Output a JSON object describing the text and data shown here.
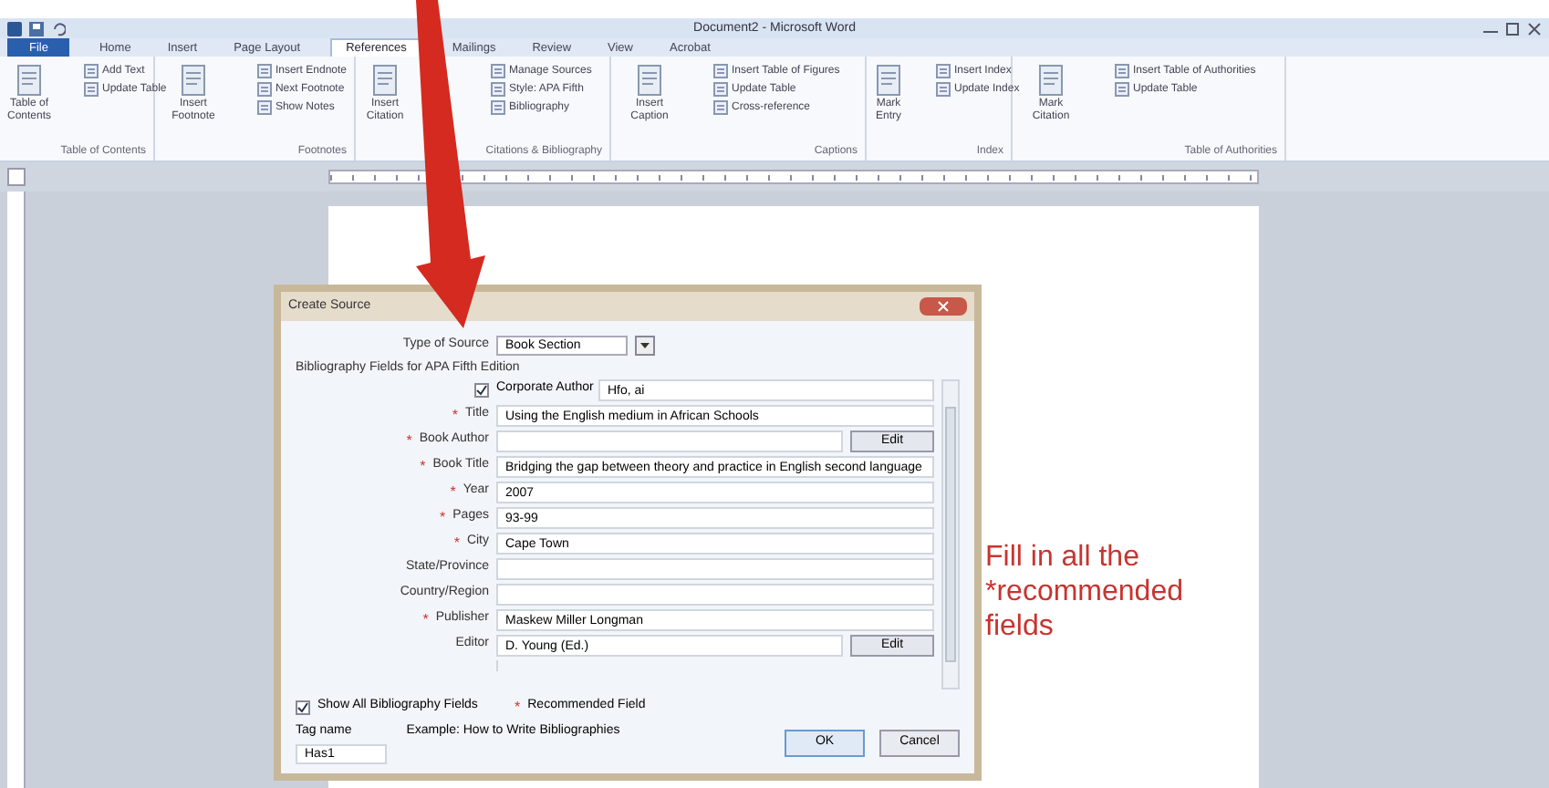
{
  "title_bar": {
    "title": "Document2 - Microsoft Word"
  },
  "tabs": [
    {
      "label": "File",
      "selected": false,
      "kind": "file"
    },
    {
      "label": "Home",
      "selected": false,
      "kind": "tab"
    },
    {
      "label": "Insert",
      "selected": false,
      "kind": "tab"
    },
    {
      "label": "Page Layout",
      "selected": false,
      "kind": "tab"
    },
    {
      "label": "References",
      "selected": true,
      "kind": "tab"
    },
    {
      "label": "Mailings",
      "selected": false,
      "kind": "tab"
    },
    {
      "label": "Review",
      "selected": false,
      "kind": "tab"
    },
    {
      "label": "View",
      "selected": false,
      "kind": "tab"
    },
    {
      "label": "Acrobat",
      "selected": false,
      "kind": "tab"
    }
  ],
  "ribbon_groups": [
    {
      "label": "Table of Contents",
      "items": [
        {
          "label": "Table of Contents",
          "kind": "large"
        },
        {
          "label": "Add Text",
          "kind": "small"
        },
        {
          "label": "Update Table",
          "kind": "small"
        }
      ]
    },
    {
      "label": "Footnotes",
      "items": [
        {
          "label": "Insert Footnote",
          "kind": "large"
        },
        {
          "label": "Insert Endnote",
          "kind": "small"
        },
        {
          "label": "Next Footnote",
          "kind": "small"
        },
        {
          "label": "Show Notes",
          "kind": "small"
        }
      ]
    },
    {
      "label": "Citations & Bibliography",
      "items": [
        {
          "label": "Insert Citation",
          "kind": "large"
        },
        {
          "label": "Manage Sources",
          "kind": "small"
        },
        {
          "label": "Style: APA Fifth",
          "kind": "small"
        },
        {
          "label": "Bibliography",
          "kind": "small"
        }
      ]
    },
    {
      "label": "Captions",
      "items": [
        {
          "label": "Insert Caption",
          "kind": "large"
        },
        {
          "label": "Insert Table of Figures",
          "kind": "small"
        },
        {
          "label": "Update Table",
          "kind": "small"
        },
        {
          "label": "Cross-reference",
          "kind": "small"
        }
      ]
    },
    {
      "label": "Index",
      "items": [
        {
          "label": "Mark Entry",
          "kind": "large"
        },
        {
          "label": "Insert Index",
          "kind": "small"
        },
        {
          "label": "Update Index",
          "kind": "small"
        }
      ]
    },
    {
      "label": "Table of Authorities",
      "items": [
        {
          "label": "Mark Citation",
          "kind": "large"
        },
        {
          "label": "Insert Table of Authorities",
          "kind": "small"
        },
        {
          "label": "Update Table",
          "kind": "small"
        }
      ]
    }
  ],
  "dialog": {
    "title": "Create Source",
    "type_label": "Type of Source",
    "type_value": "Book Section",
    "section_label": "Bibliography Fields for APA Fifth Edition",
    "fields": [
      {
        "kind": "checkbox",
        "label": "Corporate Author",
        "checked": true,
        "value": "Hfo, ai"
      },
      {
        "kind": "field",
        "label": "Title",
        "mark": "*",
        "value": "Using the English medium in African Schools"
      },
      {
        "kind": "field",
        "label": "Book Author",
        "mark": "*",
        "button": "Edit"
      },
      {
        "kind": "field",
        "label": "Book Title",
        "mark": "*",
        "value": "Bridging the gap between theory and practice in English second language"
      },
      {
        "kind": "field",
        "label": "Year",
        "mark": "*",
        "value": "2007"
      },
      {
        "kind": "field",
        "label": "Pages",
        "mark": "*",
        "value": "93-99"
      },
      {
        "kind": "field",
        "label": "City",
        "mark": "*",
        "value": "Cape Town"
      },
      {
        "kind": "field",
        "label": "State/Province"
      },
      {
        "kind": "field",
        "label": "Country/Region"
      },
      {
        "kind": "field",
        "label": "Publisher",
        "mark": "*",
        "value": "Maskew Miller Longman"
      },
      {
        "kind": "field",
        "label": "Editor",
        "value": "D. Young (Ed.)",
        "button": "Edit"
      }
    ],
    "show_all": {
      "label": "Show All Bibliography Fields",
      "checked": true
    },
    "legend_mark": "*",
    "legend": "Recommended Field",
    "tag_label": "Tag name",
    "example": "Example: How to Write Bibliographies",
    "tag_value": "Has1",
    "buttons": [
      "OK",
      "Cancel"
    ]
  },
  "annotation": "Fill in all the *recommended fields"
}
